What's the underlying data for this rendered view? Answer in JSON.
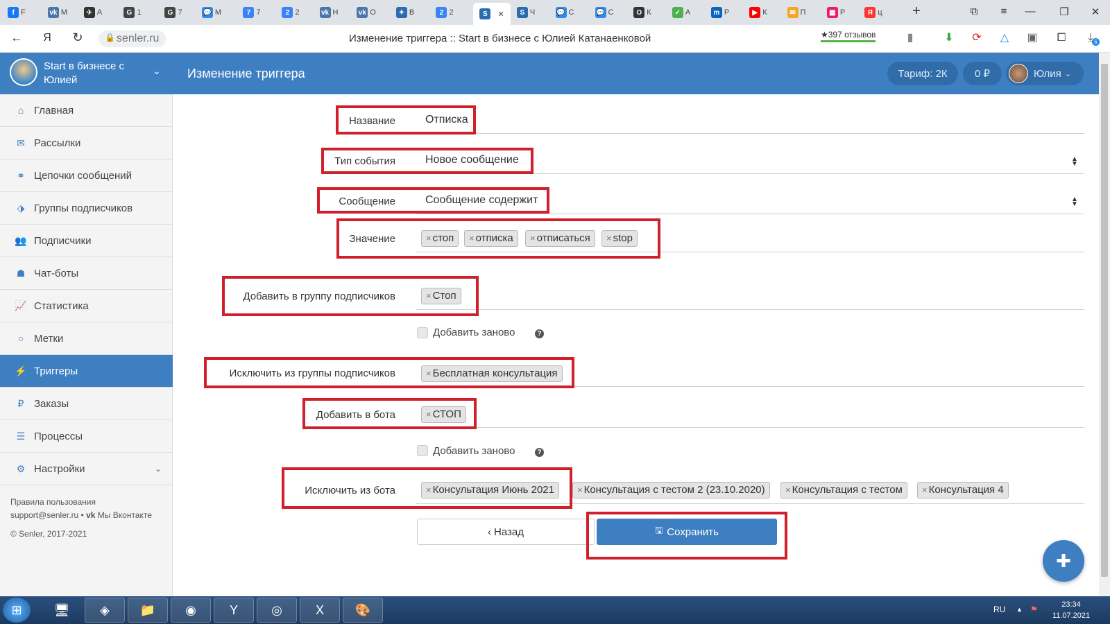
{
  "browser": {
    "tabs": [
      {
        "letter": "f",
        "label": "F",
        "color": "#1877f2"
      },
      {
        "letter": "vk",
        "label": "М",
        "color": "#4a76a8"
      },
      {
        "letter": "✈",
        "label": "А",
        "color": "#333333"
      },
      {
        "letter": "G",
        "label": "1",
        "color": "#444444"
      },
      {
        "letter": "G",
        "label": "7",
        "color": "#444444"
      },
      {
        "letter": "💬",
        "label": "М",
        "color": "#2d8cf0"
      },
      {
        "letter": "7",
        "label": "7",
        "color": "#3b82f6"
      },
      {
        "letter": "2",
        "label": "2",
        "color": "#3b82f6"
      },
      {
        "letter": "vk",
        "label": "Н",
        "color": "#4a76a8"
      },
      {
        "letter": "vk",
        "label": "О",
        "color": "#4a76a8"
      },
      {
        "letter": "✦",
        "label": "В",
        "color": "#2b6cb0"
      },
      {
        "letter": "2",
        "label": "2",
        "color": "#3b82f6"
      },
      {
        "letter": "S",
        "label": "",
        "color": "#2b6cb0"
      },
      {
        "letter": "S",
        "label": "Ч",
        "color": "#2b6cb0"
      },
      {
        "letter": "💬",
        "label": "С",
        "color": "#2d8cf0"
      },
      {
        "letter": "💬",
        "label": "С",
        "color": "#2d8cf0"
      },
      {
        "letter": "O",
        "label": "К",
        "color": "#333333"
      },
      {
        "letter": "✓",
        "label": "А",
        "color": "#4caf50"
      },
      {
        "letter": "m",
        "label": "Р",
        "color": "#0a66c2"
      },
      {
        "letter": "▶",
        "label": "К",
        "color": "#ff0000"
      },
      {
        "letter": "✉",
        "label": "П",
        "color": "#f5a623"
      },
      {
        "letter": "▦",
        "label": "Р",
        "color": "#e91e63"
      },
      {
        "letter": "Я",
        "label": "ц",
        "color": "#ff3333"
      }
    ],
    "new_tab": "+",
    "domain": "senler.ru",
    "page_title": "Изменение триггера :: Start в бизнесе с Юлией Катанаенковой",
    "reviews": "★397 отзывов",
    "download_badge": "6"
  },
  "sidebar": {
    "group_name": "Start в бизнесе с Юлией",
    "items": [
      {
        "label": "Главная",
        "icon": "home-icon",
        "glyph": "⌂"
      },
      {
        "label": "Рассылки",
        "icon": "envelope-icon",
        "glyph": "✉"
      },
      {
        "label": "Цепочки сообщений",
        "icon": "link-icon",
        "glyph": "⚭"
      },
      {
        "label": "Группы подписчиков",
        "icon": "tags-icon",
        "glyph": "⬗"
      },
      {
        "label": "Подписчики",
        "icon": "users-icon",
        "glyph": "👥"
      },
      {
        "label": "Чат-боты",
        "icon": "android-icon",
        "glyph": "☗"
      },
      {
        "label": "Статистика",
        "icon": "chart-icon",
        "glyph": "📈"
      },
      {
        "label": "Метки",
        "icon": "circle-icon",
        "glyph": "○"
      },
      {
        "label": "Триггеры",
        "icon": "bolt-icon",
        "glyph": "⚡"
      },
      {
        "label": "Заказы",
        "icon": "ruble-icon",
        "glyph": "₽"
      },
      {
        "label": "Процессы",
        "icon": "tasks-icon",
        "glyph": "☰"
      },
      {
        "label": "Настройки",
        "icon": "cogs-icon",
        "glyph": "⚙"
      }
    ],
    "footer": {
      "rules": "Правила пользования",
      "support": "support@senler.ru • ",
      "vk": "Мы Вконтакте",
      "copyright": "© Senler, 2017-2021"
    }
  },
  "header": {
    "title": "Изменение триггера",
    "tariff": "Тариф: 2К",
    "balance": "0 ₽",
    "user": "Юлия"
  },
  "form": {
    "name_label": "Название",
    "name_value": "Отписка",
    "event_label": "Тип события",
    "event_value": "Новое сообщение",
    "message_label": "Сообщение",
    "message_value": "Сообщение содержит",
    "value_label": "Значение",
    "value_tags": [
      "стоп",
      "отписка",
      "отписаться",
      "stop"
    ],
    "add_group_label": "Добавить в группу подписчиков",
    "add_group_tags": [
      "Стоп"
    ],
    "readd_label": "Добавить заново",
    "exclude_group_label": "Исключить из группы подписчиков",
    "exclude_group_tags": [
      "Бесплатная консультация"
    ],
    "add_bot_label": "Добавить в бота",
    "add_bot_tags": [
      "СТОП"
    ],
    "readd_bot_label": "Добавить заново",
    "exclude_bot_label": "Исключить из бота",
    "exclude_bot_tags": [
      "Консультация Июнь 2021",
      "Консультация с тестом 2 (23.10.2020)",
      "Консультация с тестом",
      "Консультация 4"
    ],
    "back_label": "Назад",
    "save_label": "Сохранить"
  },
  "taskbar": {
    "lang": "RU",
    "time": "23:34",
    "date": "11.07.2021"
  }
}
